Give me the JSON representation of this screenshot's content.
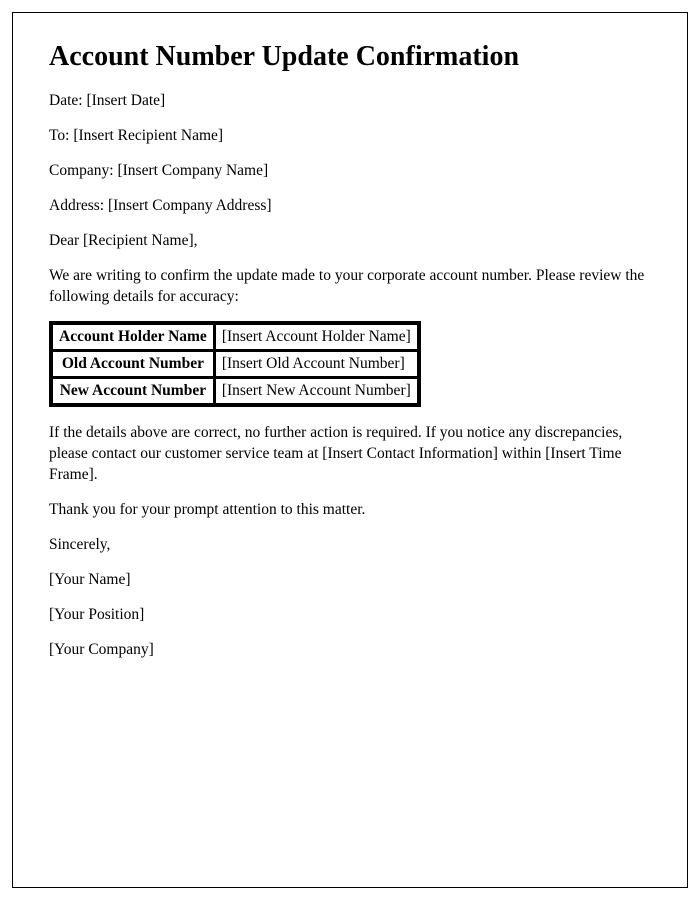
{
  "title": "Account Number Update Confirmation",
  "fields": {
    "date_label": "Date: ",
    "date_value": "[Insert Date]",
    "to_label": "To: ",
    "to_value": "[Insert Recipient Name]",
    "company_label": "Company: ",
    "company_value": "[Insert Company Name]",
    "address_label": "Address: ",
    "address_value": "[Insert Company Address]"
  },
  "salutation_prefix": "Dear ",
  "salutation_name": "[Recipient Name]",
  "salutation_suffix": ",",
  "intro": "We are writing to confirm the update made to your corporate account number. Please review the following details for accuracy:",
  "table": {
    "row1_label": "Account Holder Name",
    "row1_value": "[Insert Account Holder Name]",
    "row2_label": "Old Account Number",
    "row2_value": "[Insert Old Account Number]",
    "row3_label": "New Account Number",
    "row3_value": "[Insert New Account Number]"
  },
  "para_followup": "If the details above are correct, no further action is required. If you notice any discrepancies, please contact our customer service team at [Insert Contact Information] within [Insert Time Frame].",
  "para_thanks": "Thank you for your prompt attention to this matter.",
  "closing": "Sincerely,",
  "signer_name": "[Your Name]",
  "signer_position": "[Your Position]",
  "signer_company": "[Your Company]"
}
